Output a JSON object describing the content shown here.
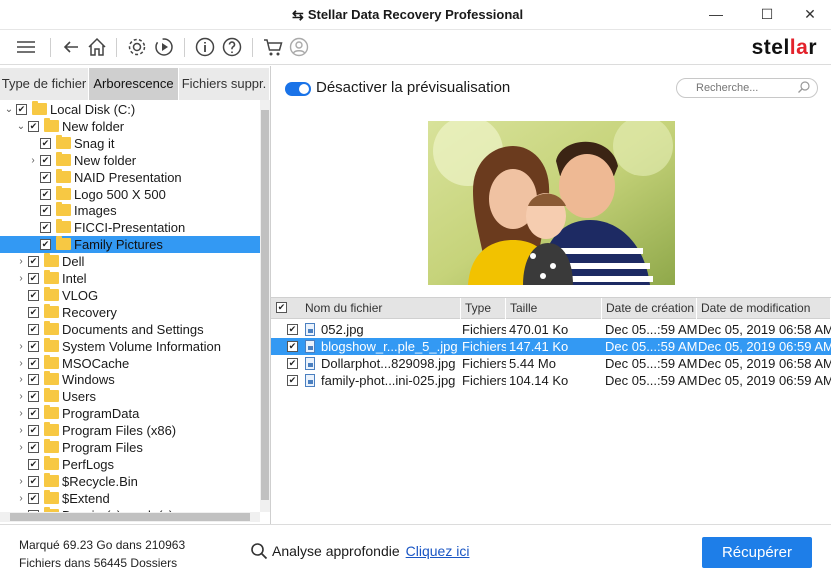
{
  "window": {
    "title": "Stellar Data Recovery Professional",
    "minimize": "—",
    "maximize": "☐",
    "close": "✕"
  },
  "brand": {
    "pre": "stel",
    "mid": "la",
    "post": "r"
  },
  "tabs": [
    "Type de fichier",
    "Arborescence",
    "Fichiers suppr."
  ],
  "tree": [
    {
      "label": "Local Disk (C:)",
      "level": 0,
      "expander": "v"
    },
    {
      "label": "New folder",
      "level": 1,
      "expander": "v"
    },
    {
      "label": "Snag it",
      "level": 2,
      "expander": ""
    },
    {
      "label": "New folder",
      "level": 2,
      "expander": ">"
    },
    {
      "label": "NAID Presentation",
      "level": 2,
      "expander": ""
    },
    {
      "label": "Logo 500 X 500",
      "level": 2,
      "expander": ""
    },
    {
      "label": "Images",
      "level": 2,
      "expander": ""
    },
    {
      "label": "FICCI-Presentation",
      "level": 2,
      "expander": ""
    },
    {
      "label": "Family Pictures",
      "level": 2,
      "expander": "",
      "selected": true
    },
    {
      "label": "Dell",
      "level": 1,
      "expander": ">"
    },
    {
      "label": "Intel",
      "level": 1,
      "expander": ">"
    },
    {
      "label": "VLOG",
      "level": 1,
      "expander": ""
    },
    {
      "label": "Recovery",
      "level": 1,
      "expander": ""
    },
    {
      "label": "Documents and Settings",
      "level": 1,
      "expander": ""
    },
    {
      "label": "System Volume Information",
      "level": 1,
      "expander": ">"
    },
    {
      "label": "MSOCache",
      "level": 1,
      "expander": ">"
    },
    {
      "label": "Windows",
      "level": 1,
      "expander": ">"
    },
    {
      "label": "Users",
      "level": 1,
      "expander": ">"
    },
    {
      "label": "ProgramData",
      "level": 1,
      "expander": ">"
    },
    {
      "label": "Program Files (x86)",
      "level": 1,
      "expander": ">"
    },
    {
      "label": "Program Files",
      "level": 1,
      "expander": ">"
    },
    {
      "label": "PerfLogs",
      "level": 1,
      "expander": ""
    },
    {
      "label": "$Recycle.Bin",
      "level": 1,
      "expander": ">"
    },
    {
      "label": "$Extend",
      "level": 1,
      "expander": ">"
    },
    {
      "label": "Dossier(s) perdu(s)",
      "level": 1,
      "expander": ">"
    }
  ],
  "preview": {
    "toggle_label": "Désactiver la prévisualisation",
    "toggle_on": true,
    "search_placeholder": "Recherche..."
  },
  "table": {
    "headers": [
      "Nom du fichier",
      "Type",
      "Taille",
      "Date de création",
      "Date de modification"
    ],
    "rows": [
      {
        "name": "052.jpg",
        "type": "Fichiers",
        "size": "470.01 Ko",
        "created": "Dec 05...:59 AM",
        "modified": "Dec 05, 2019 06:58 AM",
        "selected": false
      },
      {
        "name": "blogshow_r...ple_5_.jpg",
        "type": "Fichiers",
        "size": "147.41 Ko",
        "created": "Dec 05...:59 AM",
        "modified": "Dec 05, 2019 06:59 AM",
        "selected": true
      },
      {
        "name": "Dollarphot...829098.jpg",
        "type": "Fichiers",
        "size": "5.44 Mo",
        "created": "Dec 05...:59 AM",
        "modified": "Dec 05, 2019 06:58 AM",
        "selected": false
      },
      {
        "name": "family-phot...ini-025.jpg",
        "type": "Fichiers",
        "size": "104.14 Ko",
        "created": "Dec 05...:59 AM",
        "modified": "Dec 05, 2019 06:59 AM",
        "selected": false
      }
    ]
  },
  "status": {
    "line1": "Marqué 69.23 Go dans 210963",
    "line2": "Fichiers dans 56445 Dossiers",
    "deep_scan_label": "Analyse approfondie",
    "deep_scan_link": "Cliquez ici",
    "recover_button": "Récupérer"
  },
  "colors": {
    "accent": "#1e7ee8",
    "selection": "#3399f3",
    "folder": "#f7c843",
    "brand_red": "#e3222b"
  }
}
